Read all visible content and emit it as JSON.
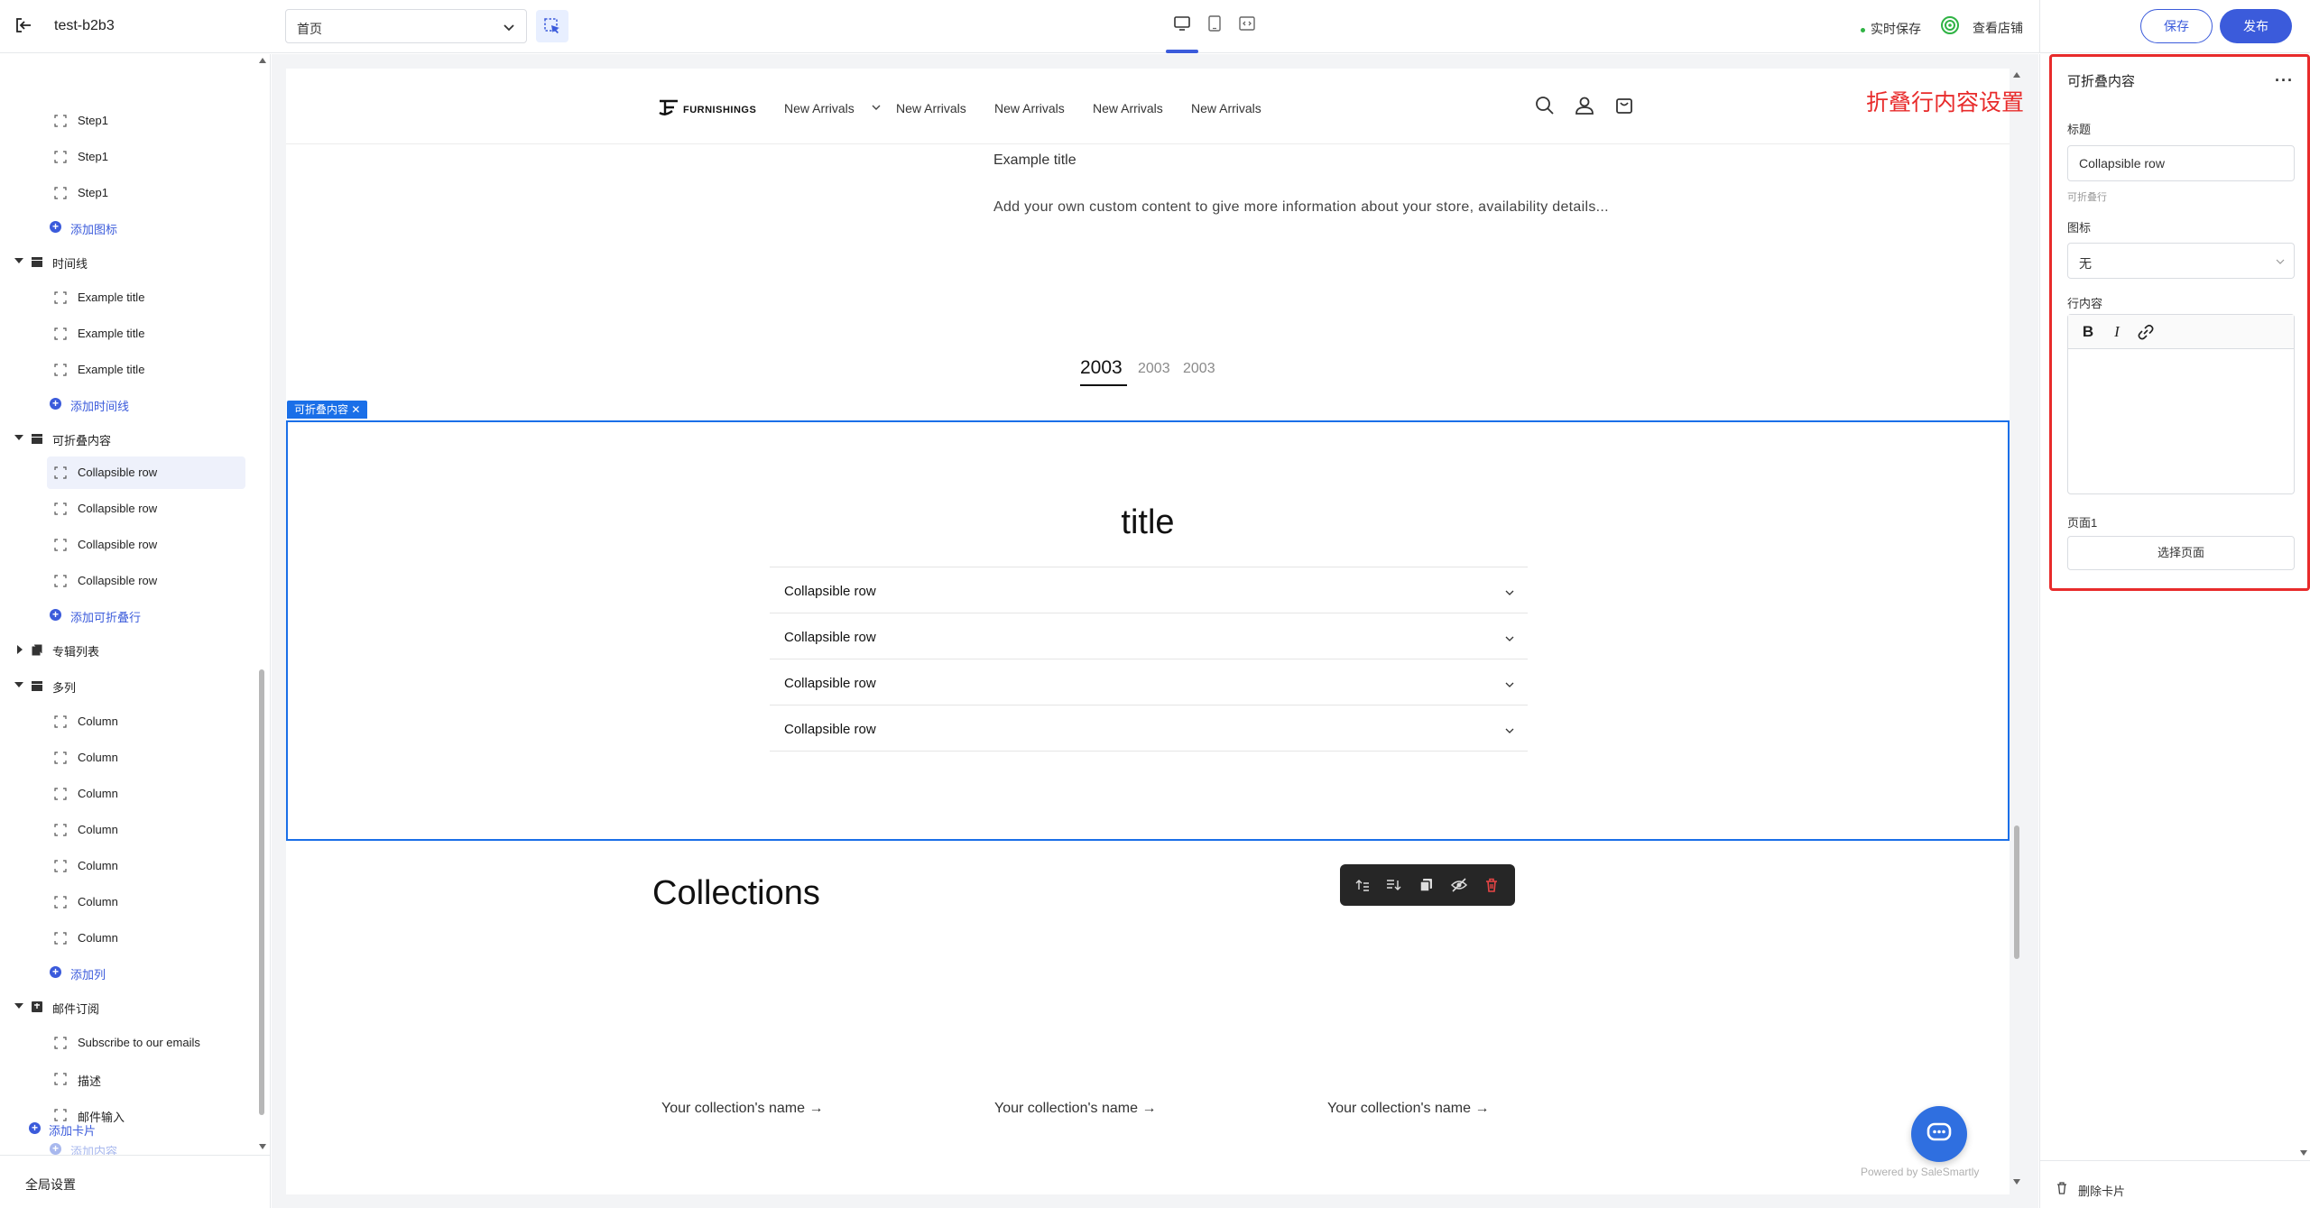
{
  "topbar": {
    "store_name": "test-b2b3",
    "page_select_value": "首页",
    "live_save": "实时保存",
    "view_store": "查看店铺",
    "save": "保存",
    "publish": "发布"
  },
  "sidebar": {
    "steps": [
      "Step1",
      "Step1",
      "Step1"
    ],
    "add_icon": "添加图标",
    "timeline_group": "时间线",
    "timeline_items": [
      "Example title",
      "Example title",
      "Example title"
    ],
    "add_timeline": "添加时间线",
    "collapsible_group": "可折叠内容",
    "collapsible_items": [
      "Collapsible row",
      "Collapsible row",
      "Collapsible row",
      "Collapsible row"
    ],
    "add_collapsible": "添加可折叠行",
    "collection_list_group": "专辑列表",
    "multicolumn_group": "多列",
    "columns": [
      "Column",
      "Column",
      "Column",
      "Column",
      "Column",
      "Column",
      "Column"
    ],
    "add_column": "添加列",
    "email_group": "邮件订阅",
    "email_items": [
      "Subscribe to our emails",
      "描述",
      "邮件输入"
    ],
    "add_content": "添加内容",
    "add_card": "添加卡片",
    "global_settings": "全局设置"
  },
  "preview": {
    "logo_text": "FURNISHINGS",
    "nav": [
      "New Arrivals",
      "New Arrivals",
      "New Arrivals",
      "New Arrivals",
      "New Arrivals"
    ],
    "example_title": "Example title",
    "example_body": "Add your own custom content to give more information about your store, availability details...",
    "timeline_tabs": [
      "2003",
      "2003",
      "2003"
    ],
    "section_tag": "可折叠内容",
    "section_title": "title",
    "rows": [
      "Collapsible row",
      "Collapsible row",
      "Collapsible row",
      "Collapsible row"
    ],
    "collections_title": "Collections",
    "collection_links": [
      "Your collection's name →",
      "Your collection's name →",
      "Your collection's name →"
    ],
    "powered_by": "Powered by SaleSmartly"
  },
  "annotation": "折叠行内容设置",
  "panel": {
    "title": "可折叠内容",
    "more": "···",
    "heading_label": "标题",
    "heading_value": "Collapsible row",
    "heading_hint": "可折叠行",
    "icon_label": "图标",
    "icon_value": "无",
    "content_label": "行内容",
    "page_label": "页面1",
    "choose_page": "选择页面",
    "delete_card": "删除卡片"
  },
  "colors": {
    "accent": "#3b5bdb",
    "selection": "#1a6fe8",
    "annotation": "#e82b2b",
    "live_dot": "#2fb344"
  }
}
